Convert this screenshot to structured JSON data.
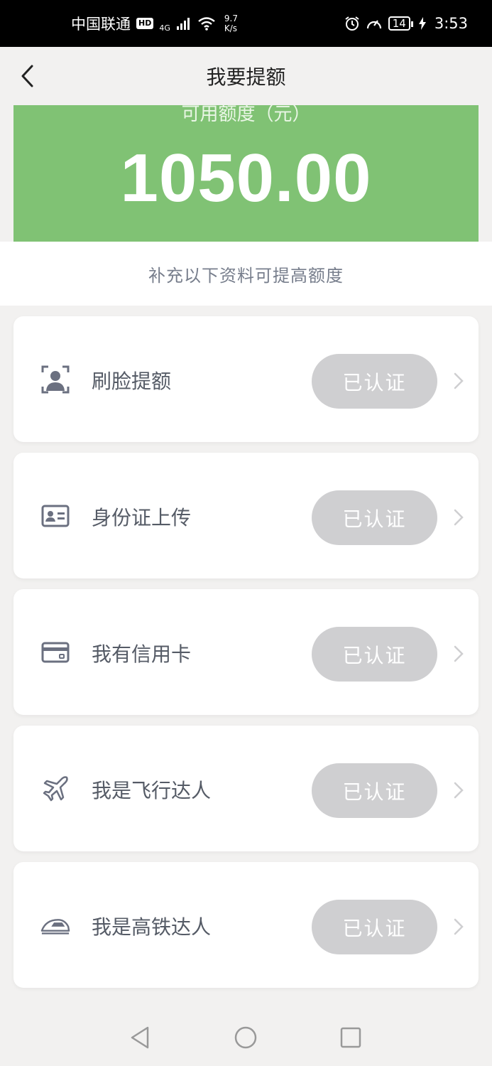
{
  "status_bar": {
    "carrier": "中国联通",
    "hd": "HD",
    "network": "4G",
    "speed_value": "9.7",
    "speed_unit": "K/s",
    "battery": "14",
    "time": "3:53"
  },
  "header": {
    "title": "我要提额"
  },
  "credit": {
    "label": "可用额度（元）",
    "amount": "1050.00",
    "color": "#80c274"
  },
  "hint": "补充以下资料可提高额度",
  "items": [
    {
      "label": "刷脸提额",
      "status": "已认证",
      "icon": "face-id-icon"
    },
    {
      "label": "身份证上传",
      "status": "已认证",
      "icon": "id-card-icon"
    },
    {
      "label": "我有信用卡",
      "status": "已认证",
      "icon": "credit-card-icon"
    },
    {
      "label": "我是飞行达人",
      "status": "已认证",
      "icon": "airplane-icon"
    },
    {
      "label": "我是高铁达人",
      "status": "已认证",
      "icon": "high-speed-train-icon"
    }
  ],
  "colors": {
    "pill": "#cfcfd1",
    "icon": "#6b7080",
    "background": "#f2f1f0"
  }
}
